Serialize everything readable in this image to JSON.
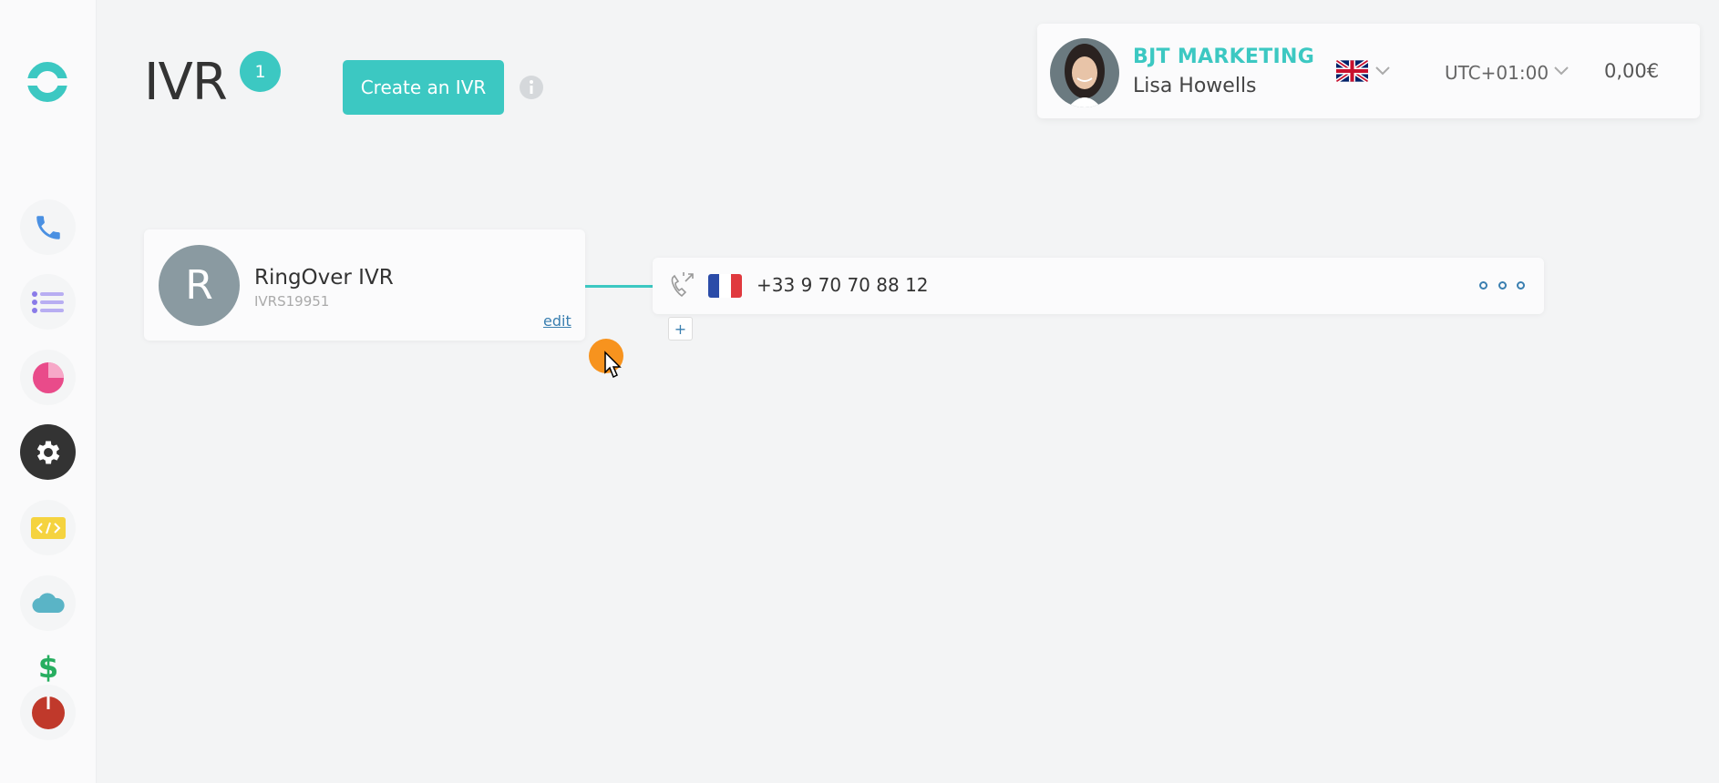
{
  "sidebar": {
    "logo": "ringover-logo-icon",
    "items": [
      {
        "name": "phone",
        "icon": "phone-icon",
        "color": "#4a90e2"
      },
      {
        "name": "list",
        "icon": "list-icon",
        "color": "#8a7be8"
      },
      {
        "name": "stats",
        "icon": "pie-chart-icon",
        "color": "#e94b8a"
      },
      {
        "name": "settings",
        "icon": "gear-icon",
        "color": "#333333",
        "active": true
      },
      {
        "name": "developer",
        "icon": "code-icon",
        "color": "#f5d33f"
      },
      {
        "name": "cloud",
        "icon": "cloud-icon",
        "color": "#5ab4c6"
      },
      {
        "name": "billing",
        "icon": "dollar-icon",
        "color": "#27ae60"
      },
      {
        "name": "logout",
        "icon": "power-icon",
        "color": "#c0392b"
      }
    ]
  },
  "header": {
    "title": "IVR",
    "count": "1",
    "create_label": "Create an IVR"
  },
  "user_panel": {
    "company": "BJT MARKETING",
    "user": "Lisa Howells",
    "language_flag": "uk-flag-icon",
    "timezone": "UTC+01:00",
    "balance": "0,00€"
  },
  "ivr": {
    "avatar_letter": "R",
    "name": "RingOver IVR",
    "id": "IVRS19951",
    "edit_label": "edit"
  },
  "number": {
    "flag": "fr-flag-icon",
    "value": "+33 9 70 70 88 12",
    "add_label": "+"
  },
  "colors": {
    "accent": "#3cc8c2",
    "link": "#3a7fb0",
    "cursor": "#f7931e"
  }
}
